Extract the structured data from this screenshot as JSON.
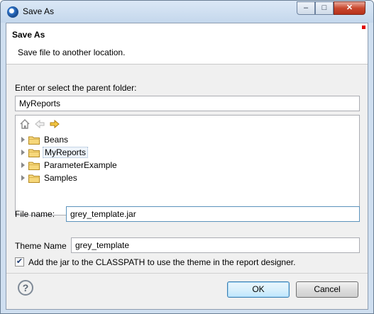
{
  "window": {
    "title": "Save As",
    "minimize_glyph": "–",
    "maximize_glyph": "□",
    "close_glyph": "✕"
  },
  "header": {
    "title": "Save As",
    "description": "Save file to another location."
  },
  "folder": {
    "label": "Enter or select the parent folder:",
    "value": "MyReports"
  },
  "tree": {
    "toolbar": [
      "home-icon",
      "back-arrow-icon",
      "forward-arrow-icon"
    ],
    "items": [
      {
        "label": "Beans",
        "selected": false
      },
      {
        "label": "MyReports",
        "selected": true
      },
      {
        "label": "ParameterExample",
        "selected": false
      },
      {
        "label": "Samples",
        "selected": false
      }
    ]
  },
  "file": {
    "label": "File name:",
    "value": "grey_template.jar"
  },
  "theme": {
    "label": "Theme Name",
    "value": "grey_template"
  },
  "classpath": {
    "checked": true,
    "label": "Add the jar to the CLASSPATH to use the theme in the report designer."
  },
  "buttons": {
    "help": "?",
    "ok": "OK",
    "cancel": "Cancel"
  },
  "colors": {
    "selection": "#eef4fb",
    "default_button_border": "#3c7fb1",
    "close_button": "#c9482f"
  }
}
